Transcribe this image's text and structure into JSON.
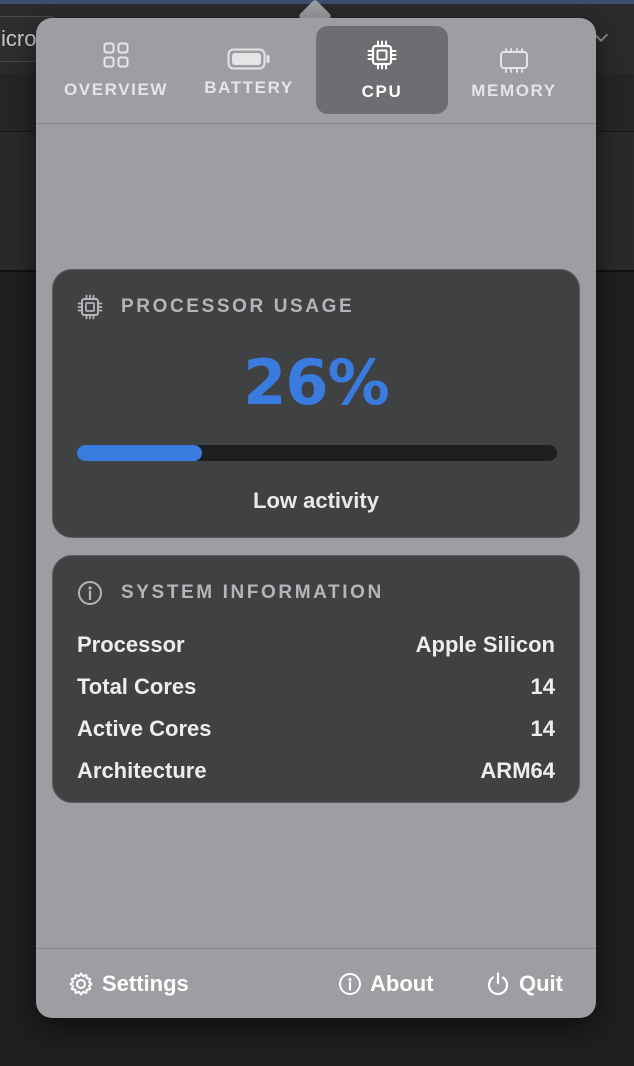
{
  "background": {
    "field_text": "icro"
  },
  "tabs": [
    {
      "label": "OVERVIEW",
      "icon": "grid-icon"
    },
    {
      "label": "BATTERY",
      "icon": "battery-icon"
    },
    {
      "label": "CPU",
      "icon": "cpu-chip-icon",
      "active": true
    },
    {
      "label": "MEMORY",
      "icon": "memory-chip-icon"
    }
  ],
  "usage": {
    "title": "PROCESSOR USAGE",
    "percent_text": "26%",
    "percent": 0.26,
    "status": "Low activity"
  },
  "info": {
    "title": "SYSTEM INFORMATION",
    "rows": [
      {
        "label": "Processor",
        "value": "Apple Silicon"
      },
      {
        "label": "Total Cores",
        "value": "14"
      },
      {
        "label": "Active Cores",
        "value": "14"
      },
      {
        "label": "Architecture",
        "value": "ARM64"
      }
    ]
  },
  "footer": {
    "settings": "Settings",
    "about": "About",
    "quit": "Quit"
  },
  "colors": {
    "accent": "#3a7be0",
    "popover": "#9c9ea1",
    "card": "#404142"
  }
}
